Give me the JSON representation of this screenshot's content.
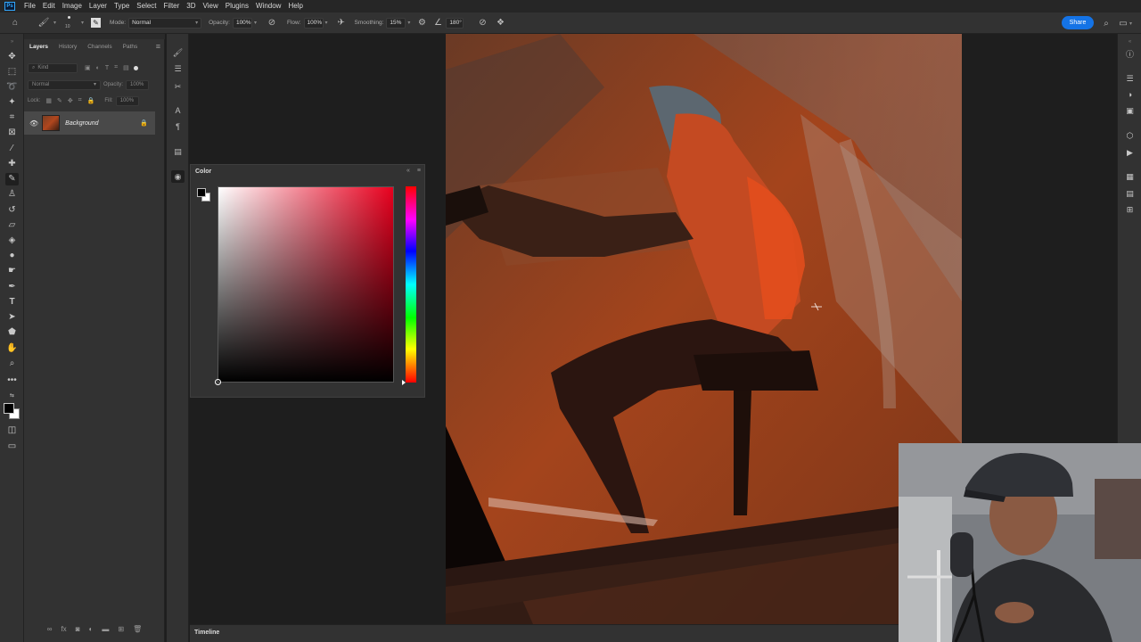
{
  "app": {
    "logo": "Ps"
  },
  "menu": [
    "File",
    "Edit",
    "Image",
    "Layer",
    "Type",
    "Select",
    "Filter",
    "3D",
    "View",
    "Plugins",
    "Window",
    "Help"
  ],
  "options": {
    "brush_size": "10",
    "mode_label": "Mode:",
    "mode_value": "Normal",
    "opacity_label": "Opacity:",
    "opacity_value": "100%",
    "flow_label": "Flow:",
    "flow_value": "100%",
    "smoothing_label": "Smoothing:",
    "smoothing_value": "15%",
    "angle_value": "180°",
    "share_label": "Share"
  },
  "layers_panel": {
    "tabs": [
      "Layers",
      "History",
      "Channels",
      "Paths"
    ],
    "kind_placeholder": "Kind",
    "blend_mode": "Normal",
    "opacity_label": "Opacity:",
    "opacity_value": "100%",
    "lock_label": "Lock:",
    "fill_label": "Fill:",
    "fill_value": "100%",
    "layers": [
      {
        "name": "Background",
        "visible": true,
        "locked": true
      }
    ]
  },
  "color_panel": {
    "title": "Color",
    "hue_color": "#e8001e",
    "foreground": "#000000",
    "background": "#ffffff"
  },
  "timeline": {
    "label": "Timeline"
  },
  "icons": {
    "home": "home-icon",
    "brush": "brush-icon",
    "eye": "eye-icon",
    "lock": "lock-icon",
    "search": "search-icon"
  }
}
